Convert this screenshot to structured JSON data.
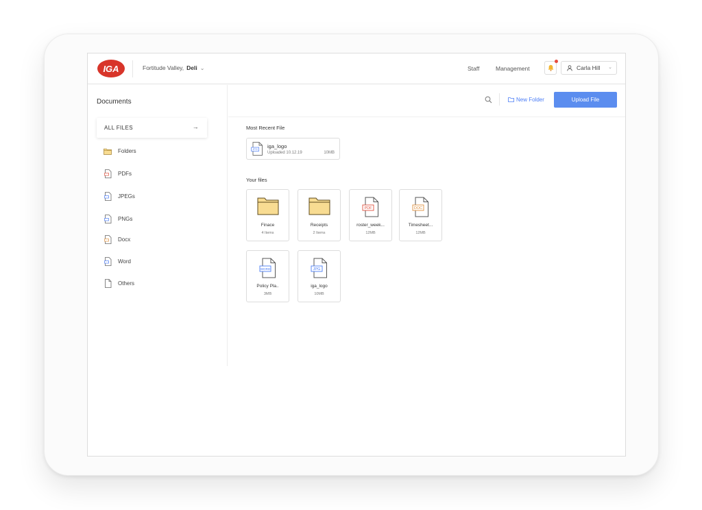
{
  "header": {
    "logo_text": "IGA",
    "store_prefix": "Fortitude Valley,",
    "store_name": "Deli",
    "nav": [
      "Staff",
      "Management"
    ],
    "user_name": "Carla Hill"
  },
  "sidebar": {
    "title": "Documents",
    "all_files": "ALL FILES",
    "items": [
      {
        "label": "Folders",
        "icon": "folder-icon"
      },
      {
        "label": "PDFs",
        "icon": "pdf-file-icon"
      },
      {
        "label": "JPEGs",
        "icon": "jpeg-file-icon"
      },
      {
        "label": "PNGs",
        "icon": "png-file-icon"
      },
      {
        "label": "Docx",
        "icon": "docx-file-icon"
      },
      {
        "label": "Word",
        "icon": "word-file-icon"
      },
      {
        "label": "Others",
        "icon": "blank-file-icon"
      }
    ]
  },
  "toolbar": {
    "new_folder": "New Folder",
    "upload": "Upload File"
  },
  "recent": {
    "label": "Most Recent File",
    "name": "iga_logo",
    "meta": "Uploaded 10.12.19",
    "size": "10MB",
    "badge": "JPG"
  },
  "files": {
    "label": "Your files",
    "items": [
      {
        "name": "Finace",
        "meta": "4 Items",
        "kind": "folder"
      },
      {
        "name": "Receipts",
        "meta": "2 Items",
        "kind": "folder"
      },
      {
        "name": "roster_week...",
        "meta": "12MB",
        "kind": "file",
        "badge": "PDF",
        "color": "#e0503d"
      },
      {
        "name": "Timesheet...",
        "meta": "12MB",
        "kind": "file",
        "badge": "DOC",
        "color": "#e0913d"
      },
      {
        "name": "Policy Pla..",
        "meta": "3MB",
        "kind": "file",
        "badge": "WORD",
        "color": "#4a7cf6"
      },
      {
        "name": "iga_logo",
        "meta": "10MB",
        "kind": "file",
        "badge": "JPG",
        "color": "#4a7cf6"
      }
    ]
  },
  "colors": {
    "accent": "#5b8def",
    "logo_red": "#d8352a",
    "folder_fill": "#f8dc92"
  }
}
